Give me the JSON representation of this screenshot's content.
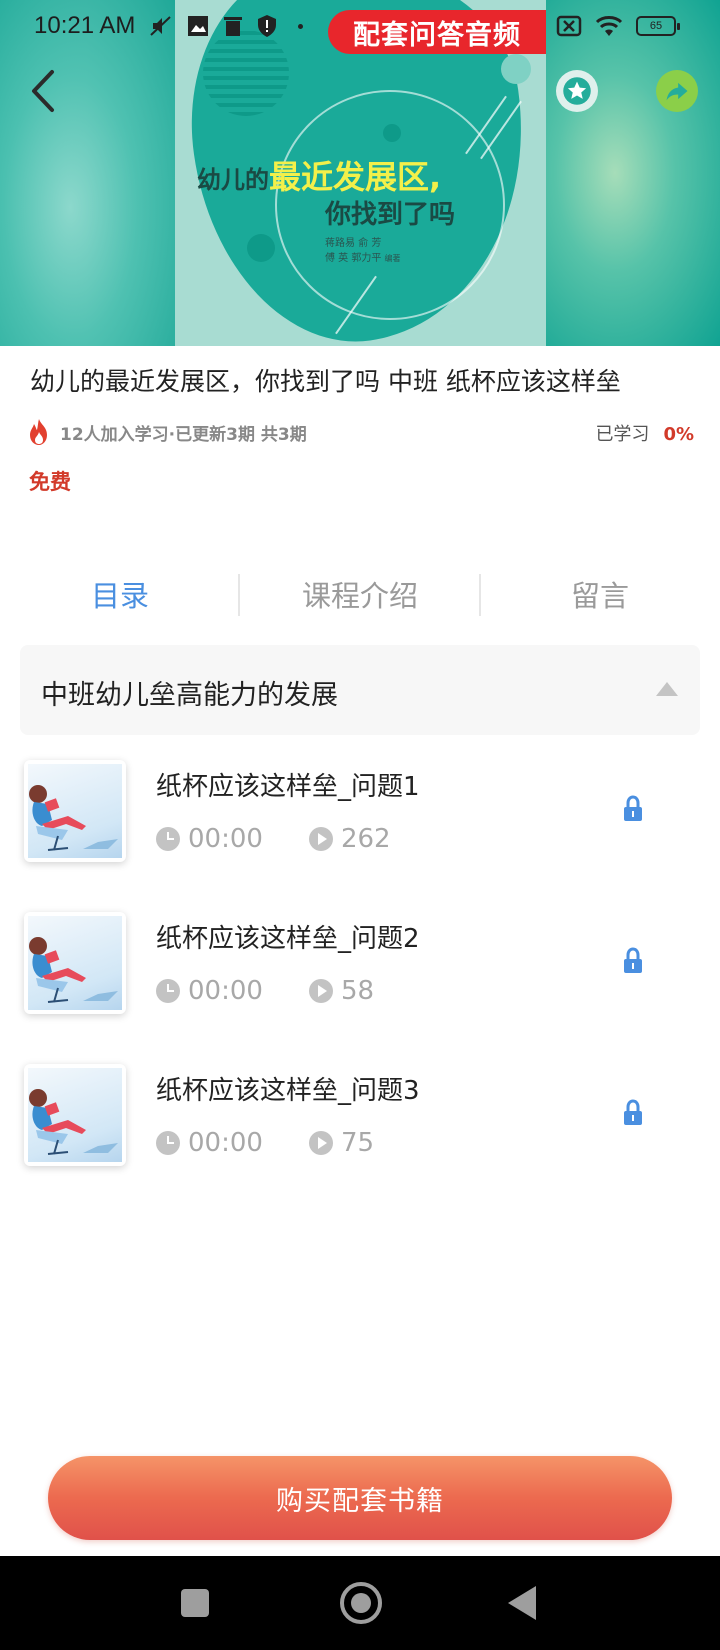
{
  "status_bar": {
    "time": "10:21 AM",
    "battery": "65"
  },
  "banner": {
    "audio_label": "配套问答音频"
  },
  "cover": {
    "title_prefix": "幼儿的",
    "title_highlight": "最近发展区,",
    "title_line2": "你找到了吗",
    "authors_line1": "蒋路易  俞  芳",
    "authors_line2": "傅  英  郭力平",
    "editor_label": "编著"
  },
  "course": {
    "title": "幼儿的最近发展区，你找到了吗 中班 纸杯应该这样垒",
    "meta": "12人加入学习·已更新3期 共3期",
    "learned_label": "已学习",
    "learned_pct": "0%",
    "price": "免费"
  },
  "tabs": [
    {
      "label": "目录",
      "active": true
    },
    {
      "label": "课程介绍",
      "active": false
    },
    {
      "label": "留言",
      "active": false
    }
  ],
  "section": {
    "title": "中班幼儿垒高能力的发展"
  },
  "lessons": [
    {
      "title": "纸杯应该这样垒_问题1",
      "duration": "00:00",
      "plays": "262"
    },
    {
      "title": "纸杯应该这样垒_问题2",
      "duration": "00:00",
      "plays": "58"
    },
    {
      "title": "纸杯应该这样垒_问题3",
      "duration": "00:00",
      "plays": "75"
    }
  ],
  "buy_button": {
    "label": "购买配套书籍"
  },
  "colors": {
    "accent_blue": "#4a8fe0",
    "price_red": "#d23a2a",
    "banner_red": "#e8262c",
    "button_orange": "#ec6a4f",
    "teal": "#1aaa99"
  },
  "icons": {
    "back": "back-arrow-icon",
    "favorite": "star-icon",
    "share": "share-arrow-icon",
    "hot": "fire-icon",
    "collapse": "triangle-up-icon",
    "duration": "clock-icon",
    "plays": "play-icon",
    "locked": "lock-icon"
  }
}
